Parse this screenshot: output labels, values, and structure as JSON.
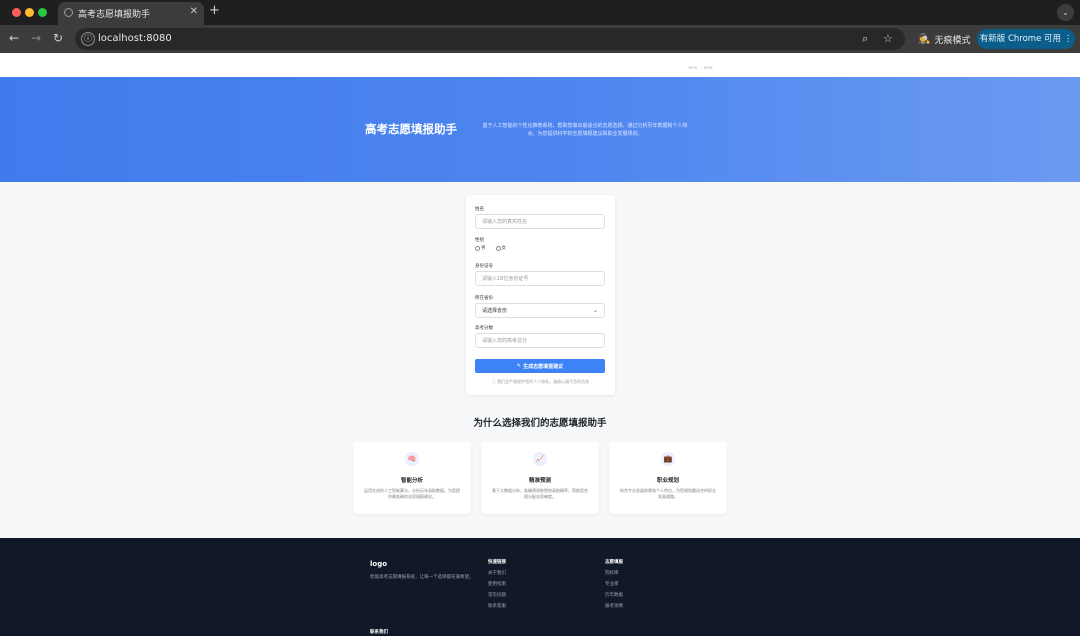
{
  "browser": {
    "tab_title": "高考志愿填报助手",
    "tab_close": "✕",
    "new_tab": "+",
    "tab_menu": "⌄",
    "url": "localhost:8080",
    "incognito_label": "无痕模式",
    "update_label": "有新版 Chrome 可用",
    "icons": {
      "back": "←",
      "forward": "→",
      "reload": "↻",
      "site_info": "ⓘ",
      "zoom": "⌕",
      "star": "☆",
      "incognito": "🕵",
      "menu": "⋮"
    }
  },
  "hero": {
    "title": "高考志愿填报助手",
    "description": "基于人工智能的个性化推荐系统，帮助您做出最适合的志愿选择。通过分析历年数据和个人特点，为您提供科学的志愿填报建议和职业发展规划。"
  },
  "form": {
    "name_label": "姓名",
    "name_placeholder": "请输入您的真实姓名",
    "gender_label": "性别",
    "gender_options": [
      "男",
      "女"
    ],
    "id_label": "身份证号",
    "id_placeholder": "请输入18位身份证号",
    "province_label": "所在省份",
    "province_value": "请选择省份",
    "score_label": "高考分数",
    "score_placeholder": "请输入您的高考总分",
    "submit_icon": "✎",
    "submit_label": "生成志愿填报建议",
    "hint": "ⓘ 我们会严格保护您的个人隐私，请放心填写您的信息"
  },
  "features": {
    "title": "为什么选择我们的志愿填报助手",
    "items": [
      {
        "icon": "🧠",
        "title": "智能分析",
        "desc": "运用先进的人工智能算法，分析历年录取数据，为您提供最准确的志愿填报建议。"
      },
      {
        "icon": "📈",
        "title": "精准预测",
        "desc": "基于大数据分析，准确预测各院校录取概率，帮助您合理分配志愿梯度。"
      },
      {
        "icon": "💼",
        "title": "职业规划",
        "desc": "结合专业发展前景和个人特点，为您规划最适合的职业发展道路。"
      }
    ]
  },
  "footer": {
    "logo": "logo",
    "desc": "智能高考志愿填报系统，让每一个选择都充满希望。",
    "quick_links_title": "快速链接",
    "quick_links": [
      "关于我们",
      "使用指南",
      "常见问题",
      "联系客服"
    ],
    "services_title": "志愿填报",
    "services": [
      "院校库",
      "专业库",
      "历年数据",
      "报考攻略"
    ],
    "contact_title": "联系我们"
  }
}
